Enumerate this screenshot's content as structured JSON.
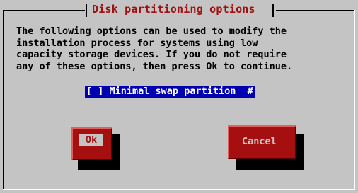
{
  "dialog": {
    "title": "Disk partitioning options",
    "message": "The following options can be used to modify the\ninstallation process for systems using low\ncapacity storage devices. If you do not require\nany of these options, then press Ok to continue.",
    "checkbox": {
      "mark": "[ ]",
      "label": "Minimal swap partition",
      "scroll_indicator": "#"
    },
    "buttons": {
      "ok_label": "Ok",
      "cancel_label": "Cancel"
    }
  },
  "colors": {
    "background": "#c4c4c4",
    "title": "#a01010",
    "button": "#a50f0f",
    "selection": "#0000b0"
  }
}
